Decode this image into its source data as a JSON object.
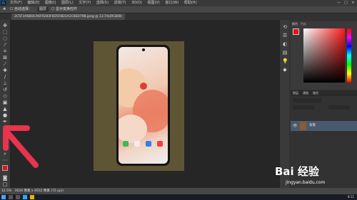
{
  "menu": [
    "文件(F)",
    "编辑(E)",
    "图像(I)",
    "图层(L)",
    "文字(Y)",
    "选择(S)",
    "滤镜(T)",
    "3D(D)",
    "视图(V)",
    "窗口(W)",
    "帮助(H)"
  ],
  "app_logo": "Ps",
  "window_controls": [
    "—",
    "□",
    "✕"
  ],
  "options": {
    "auto_select": "自动选择：",
    "layer_select": "图层",
    "transform": "显示变换控件"
  },
  "document_tab": "2C5F3A6BDCA6F9283F6D5F8D1A1C6ED79B.jpeg @ 12.5%(RGB/8)",
  "status": {
    "zoom": "12.5%",
    "info": "3024 像素 x 4032 像素 (72 ppi)"
  },
  "panels": {
    "color_tab": "颜色",
    "swatches_tab": "色板",
    "layers_tab": "图层",
    "channels_tab": "通道",
    "paths_tab": "路径"
  },
  "layer": {
    "name": "背景"
  },
  "clock": "8:11",
  "watermark": {
    "brand": "Bai 经验",
    "url": "jingyan.baidu.com"
  },
  "colors": {
    "accent": "#31a8ff",
    "arrow": "#e8344e",
    "foreground": "#e8101a"
  }
}
